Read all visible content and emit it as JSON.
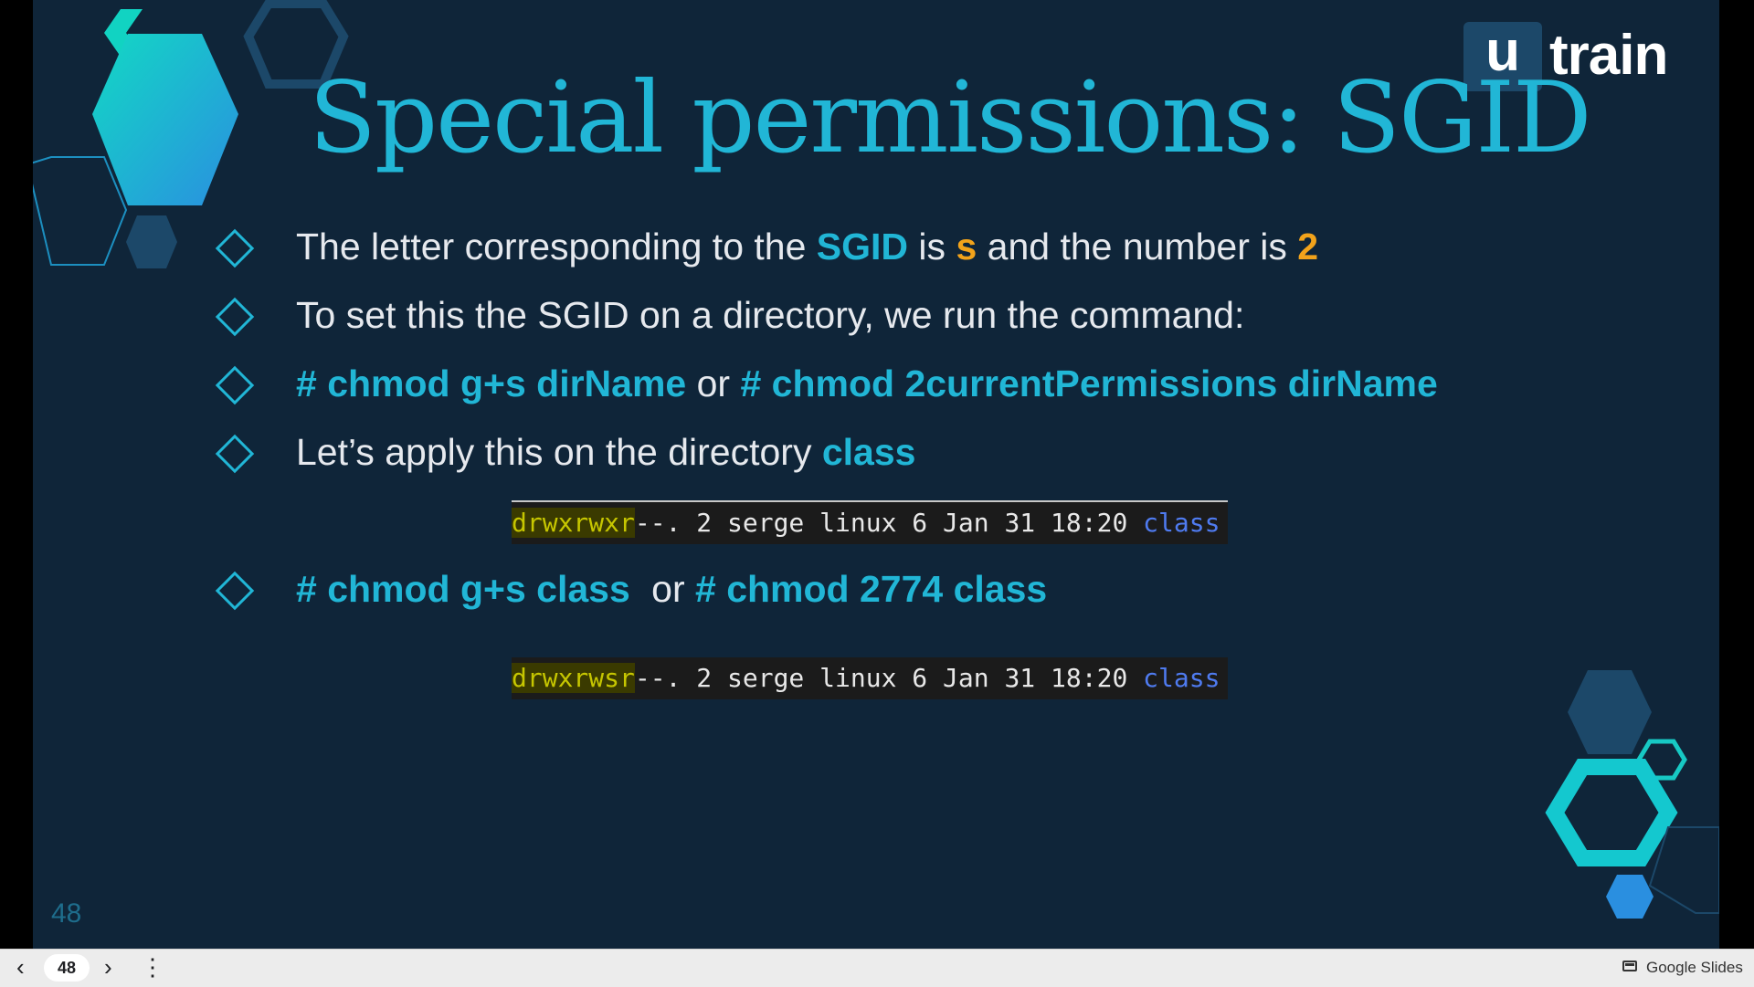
{
  "slide": {
    "title": "Special permissions: SGID",
    "page_number": "48",
    "logo": {
      "u": "u",
      "text": "train"
    },
    "bullets": [
      {
        "parts": [
          "The letter corresponding to the ",
          "SGID",
          " is ",
          "s",
          " and the number is ",
          "2"
        ]
      },
      {
        "parts": [
          "To set this the SGID on a directory, we run the command:"
        ]
      },
      {
        "parts": [
          "# chmod g+s dirName",
          " or ",
          "# chmod 2currentPermissions dirName"
        ]
      },
      {
        "parts": [
          "Let’s apply this on the directory ",
          "class"
        ]
      },
      {
        "parts": [
          "# chmod g+s class ",
          " or ",
          "# chmod 2774 class"
        ]
      }
    ],
    "terminal_before": {
      "perm": "drwxrwxr",
      "rest": "--. 2 serge linux 6 Jan 31 18:20 ",
      "name": "class"
    },
    "terminal_after": {
      "perm": "drwxrwsr",
      "rest": "--. 2 serge linux 6 Jan 31 18:20 ",
      "name": "class"
    }
  },
  "controls": {
    "prev_icon": "chevron-left-icon",
    "next_icon": "chevron-right-icon",
    "more_icon": "more-vert-icon",
    "current_page": "48",
    "brand": "Google Slides"
  },
  "colors": {
    "accent": "#21b6d6",
    "orange": "#f2a31b",
    "background": "#0f2539"
  }
}
